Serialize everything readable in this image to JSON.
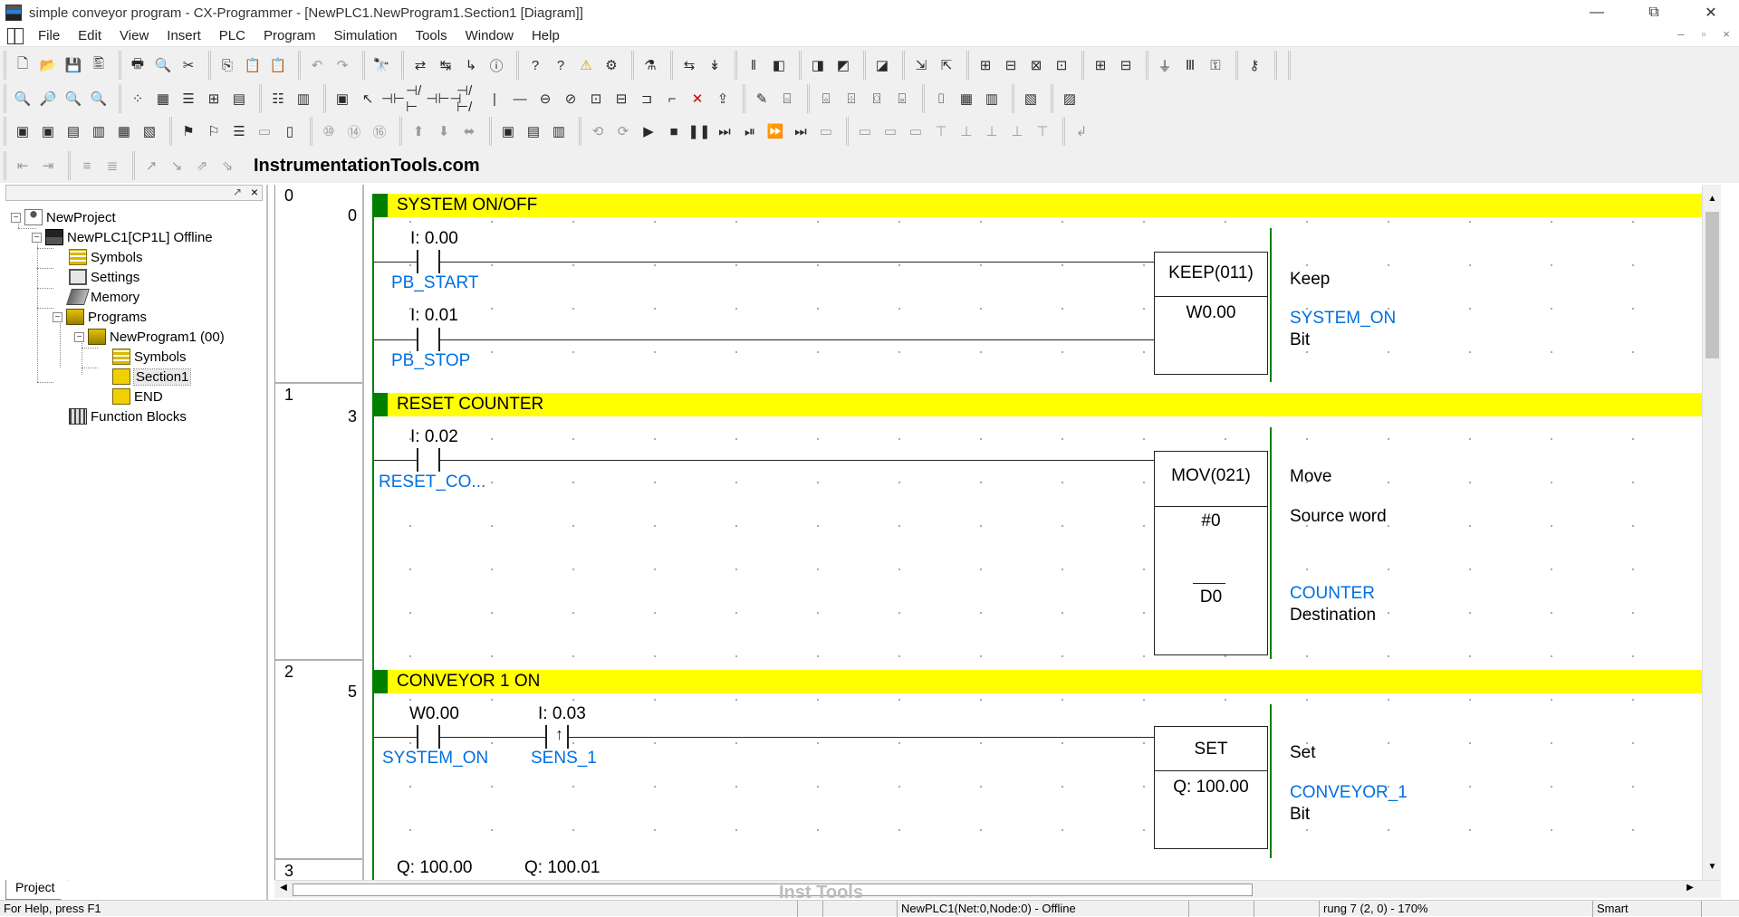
{
  "window": {
    "title": "simple conveyor program - CX-Programmer - [NewPLC1.NewProgram1.Section1 [Diagram]]",
    "controls": [
      "—",
      "⧉",
      "✕"
    ]
  },
  "menu": {
    "items": [
      "File",
      "Edit",
      "View",
      "Insert",
      "PLC",
      "Program",
      "Simulation",
      "Tools",
      "Window",
      "Help"
    ],
    "mdi_controls": [
      "–",
      "▫",
      "×"
    ]
  },
  "watermark_top": "InstrumentationTools.com",
  "project_tree": {
    "items": [
      {
        "label": "NewProject",
        "icon": "project-icon"
      },
      {
        "label": "NewPLC1[CP1L] Offline",
        "icon": "plc-icon"
      },
      {
        "label": "Symbols",
        "icon": "symbols-icon"
      },
      {
        "label": "Settings",
        "icon": "settings-icon"
      },
      {
        "label": "Memory",
        "icon": "memory-icon"
      },
      {
        "label": "Programs",
        "icon": "programs-icon"
      },
      {
        "label": "NewProgram1 (00)",
        "icon": "program-icon"
      },
      {
        "label": "Symbols",
        "icon": "symbols-icon"
      },
      {
        "label": "Section1",
        "icon": "section-icon"
      },
      {
        "label": "END",
        "icon": "section-icon"
      },
      {
        "label": "Function Blocks",
        "icon": "function-blocks-icon"
      }
    ],
    "tab_label": "Project",
    "expanders": {
      "collapse": "−"
    },
    "pin": "↗",
    "close": "×"
  },
  "rungs": [
    {
      "index": "0",
      "step": "0",
      "comment": "SYSTEM ON/OFF",
      "contacts": [
        {
          "address": "I: 0.00",
          "symbol": "PB_START"
        },
        {
          "address": "I: 0.01",
          "symbol": "PB_STOP"
        }
      ],
      "instruction": {
        "name": "KEEP(011)",
        "operand": "W0.00"
      },
      "notes": {
        "desc": "Keep",
        "symbol": "SYSTEM_ON",
        "type": "Bit"
      }
    },
    {
      "index": "1",
      "step": "3",
      "comment": "RESET COUNTER",
      "contacts": [
        {
          "address": "I: 0.02",
          "symbol": "RESET_CO..."
        }
      ],
      "instruction": {
        "name": "MOV(021)",
        "operand1": "#0",
        "operand2": "D0"
      },
      "notes": {
        "desc": "Move",
        "source": "Source word",
        "dest_symbol": "COUNTER",
        "dest": "Destination"
      }
    },
    {
      "index": "2",
      "step": "5",
      "comment": "CONVEYOR 1 ON",
      "contacts": [
        {
          "address": "W0.00",
          "symbol": "SYSTEM_ON"
        },
        {
          "address": "I: 0.03",
          "symbol": "SENS_1",
          "edge": "↑"
        }
      ],
      "instruction": {
        "name": "SET",
        "operand": "Q: 100.00"
      },
      "notes": {
        "desc": "Set",
        "symbol": "CONVEYOR_1",
        "type": "Bit"
      }
    },
    {
      "index": "3",
      "contacts": [
        {
          "address": "Q: 100.00"
        },
        {
          "address": "Q: 100.01"
        }
      ]
    }
  ],
  "scroll": {
    "up": "▲",
    "down": "▼",
    "left": "◀",
    "right": "▶"
  },
  "bottom_watermark": "Inst Tools",
  "status": {
    "help": "For Help, press F1",
    "plc": "NewPLC1(Net:0,Node:0) - Offline",
    "position": "rung 7 (2, 0) - 170%",
    "mode": "Smart"
  },
  "toolbar_icons": {
    "row1": [
      "new-icon",
      "open-icon",
      "save-icon",
      "print-preview-icon",
      "print-icon",
      "preview-icon",
      "cut-icon",
      "copy-icon",
      "paste-icon",
      "paste-special-icon",
      "undo-icon",
      "redo-icon",
      "find-icon",
      "replace-icon",
      "find-next-icon",
      "cross-ref-icon",
      "info-icon",
      "help-icon",
      "context-help-icon",
      "warning-icon",
      "online-icon",
      "monitor-icon",
      "transfer-icon",
      "compile-icon",
      "pause-icon",
      "stop-icon",
      "window1-icon",
      "window2-icon",
      "window3-icon",
      "window4-icon",
      "diff-icon",
      "diff2-icon",
      "diff3-icon",
      "grid1-icon",
      "grid2-icon",
      "grid3-icon",
      "grid4-icon",
      "force-on-icon",
      "force-off-icon",
      "tool-a-icon",
      "tool-b-icon"
    ],
    "row1_glyphs": [
      "🗋",
      "📂",
      "💾",
      "🖺",
      "🖶",
      "🔍",
      "✂",
      "⎘",
      "📋",
      "📋",
      "↶",
      "↷",
      "🔭",
      "⇄",
      "↹",
      "↳",
      "ⓘ",
      "?",
      "?",
      "⚠",
      "⚙",
      "⚗",
      "⇆",
      "↡",
      "‖",
      "◧",
      "◨",
      "◩",
      "◪",
      "⇲",
      "⇱",
      "⊞",
      "⊟",
      "⊠",
      "⊡",
      "⊞",
      "⊟",
      "⏚",
      "Ⅲ",
      "⚿",
      "⚷"
    ],
    "row2_glyphs": [
      "🔍",
      "🔎",
      "🔍",
      "🔍",
      "⁘",
      "▦",
      "☰",
      "⊞",
      "▤",
      "☷",
      "▥",
      "▣",
      "↖",
      "⊣⊢",
      "⊣/⊢",
      "⊣⊢⊣",
      "⊣/⊢/",
      "|",
      "—",
      "⊖",
      "⊘",
      "⊡",
      "⊟",
      "⊐",
      "⌐",
      "✕",
      "⇪",
      "✎",
      "⌸",
      "⌺",
      "⌹",
      "⌼",
      "⌻",
      "⌷",
      "▦",
      "▥",
      "▧",
      "▨"
    ],
    "row3_glyphs": [
      "▣",
      "▣",
      "▤",
      "▥",
      "▦",
      "▧",
      "⚑",
      "⚐",
      "☰",
      "▭",
      "▯",
      "⑩",
      "⑭",
      "⑯",
      "⬆",
      "⬇",
      "⬌",
      "▣",
      "▤",
      "▥",
      "⟲",
      "⟳",
      "▶",
      "■",
      "❚❚",
      "⏭",
      "⏯",
      "⏩",
      "⏭",
      "▭",
      "▭",
      "▭",
      "▭",
      "⊤",
      "⊥",
      "⊥",
      "⊥",
      "⊤",
      "↲"
    ],
    "row4_glyphs": [
      "⇤",
      "⇥",
      "≡",
      "≣",
      "↗",
      "↘",
      "⇗",
      "⇘"
    ]
  }
}
